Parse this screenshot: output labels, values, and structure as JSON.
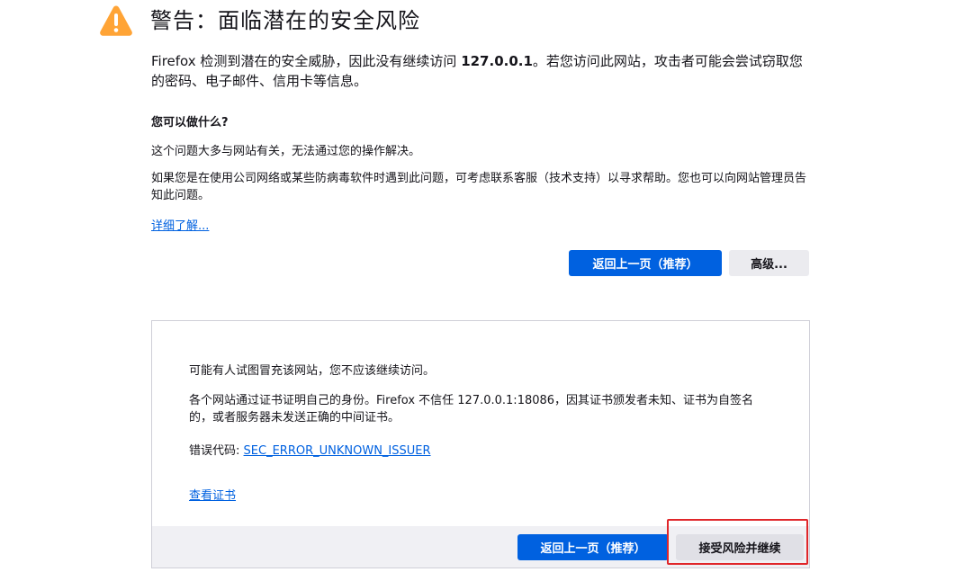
{
  "header": {
    "warning_icon": "warning-triangle-icon",
    "title": "警告：面临潜在的安全风险"
  },
  "intro": {
    "text_before": "Firefox 检测到潜在的安全威胁，因此没有继续访问 ",
    "host": "127.0.0.1",
    "text_after": "。若您访问此网站，攻击者可能会尝试窃取您的密码、电子邮件、信用卡等信息。"
  },
  "what_to_do": {
    "heading": "您可以做什么?",
    "para1": "这个问题大多与网站有关，无法通过您的操作解决。",
    "para2": "如果您是在使用公司网络或某些防病毒软件时遇到此问题，可考虑联系客服（技术支持）以寻求帮助。您也可以向网站管理员告知此问题。",
    "learn_more": "详细了解..."
  },
  "buttons": {
    "go_back": "返回上一页（推荐）",
    "advanced": "高级..."
  },
  "advanced_panel": {
    "text1": "可能有人试图冒充该网站，您不应该继续访问。",
    "text2": "各个网站通过证书证明自己的身份。Firefox 不信任 127.0.0.1:18086，因其证书颁发者未知、证书为自签名的，或者服务器未发送正确的中间证书。",
    "error_code_label": "错误代码:",
    "error_code": "SEC_ERROR_UNKNOWN_ISSUER",
    "view_certificate": "查看证书",
    "go_back": "返回上一页（推荐）",
    "accept_risk": "接受风险并继续"
  },
  "colors": {
    "accent": "#0061e0",
    "warning": "#ffa436",
    "highlight": "#e0262a"
  }
}
